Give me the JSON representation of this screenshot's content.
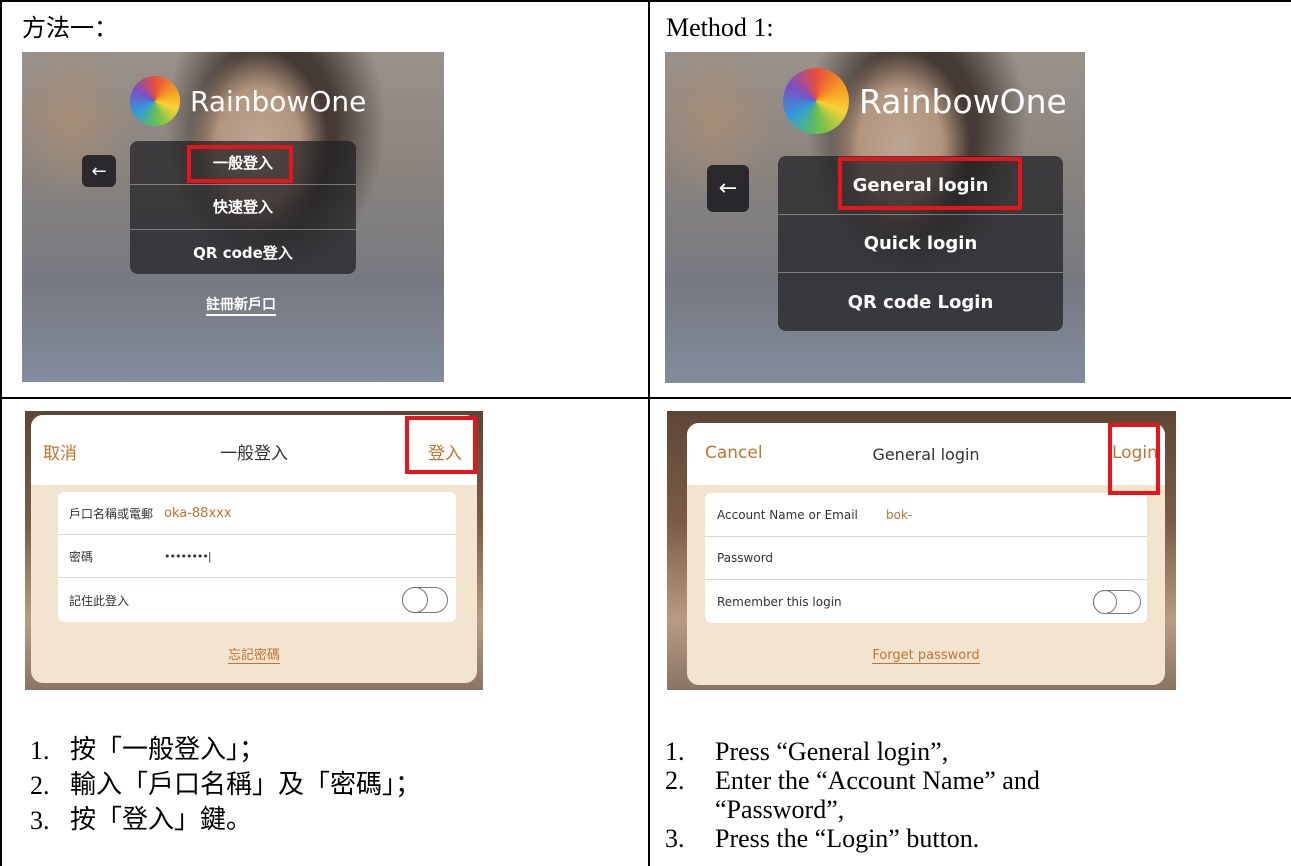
{
  "left": {
    "title": "方法一：",
    "menu": {
      "logo_text": "RainbowOne",
      "back_glyph": "←",
      "items": [
        "一般登入",
        "快速登入",
        "QR code登入"
      ],
      "register_link": "註冊新戶口"
    },
    "form": {
      "cancel": "取消",
      "title": "一般登入",
      "login": "登入",
      "fields": [
        {
          "label": "戶口名稱或電郵",
          "value": "oka-88xxx"
        },
        {
          "label": "密碼",
          "value": "••••••••|"
        },
        {
          "label": "記住此登入",
          "value": ""
        }
      ],
      "forget": "忘記密碼"
    },
    "steps": [
      {
        "num": "1.",
        "text": "按「一般登入」；"
      },
      {
        "num": "2.",
        "text": "輸入「戶口名稱」及「密碼」；"
      },
      {
        "num": "3.",
        "text": "按「登入」鍵。"
      }
    ]
  },
  "right": {
    "title": "Method 1:",
    "menu": {
      "logo_text": "RainbowOne",
      "back_glyph": "←",
      "items": [
        "General login",
        "Quick login",
        "QR code Login"
      ]
    },
    "form": {
      "cancel": "Cancel",
      "title": "General login",
      "login": "Login",
      "fields": [
        {
          "label": "Account Name or Email",
          "value": "bok-"
        },
        {
          "label": "Password",
          "value": ""
        },
        {
          "label": "Remember this login",
          "value": ""
        }
      ],
      "forget": "Forget password"
    },
    "steps": [
      {
        "num": "1.",
        "text": "Press “General login”,"
      },
      {
        "num": "2.",
        "text": "Enter the “Account Name” and “Password”,"
      },
      {
        "num": "3.",
        "text": "Press the “Login” button."
      }
    ]
  },
  "colors": {
    "highlight": "#e8141b",
    "accent": "#c0742f",
    "card": "#f3e4cf"
  },
  "icons": {
    "back": "arrow-left-icon",
    "logo": "rainbowone-logo-icon",
    "toggle": "toggle-switch-icon"
  }
}
